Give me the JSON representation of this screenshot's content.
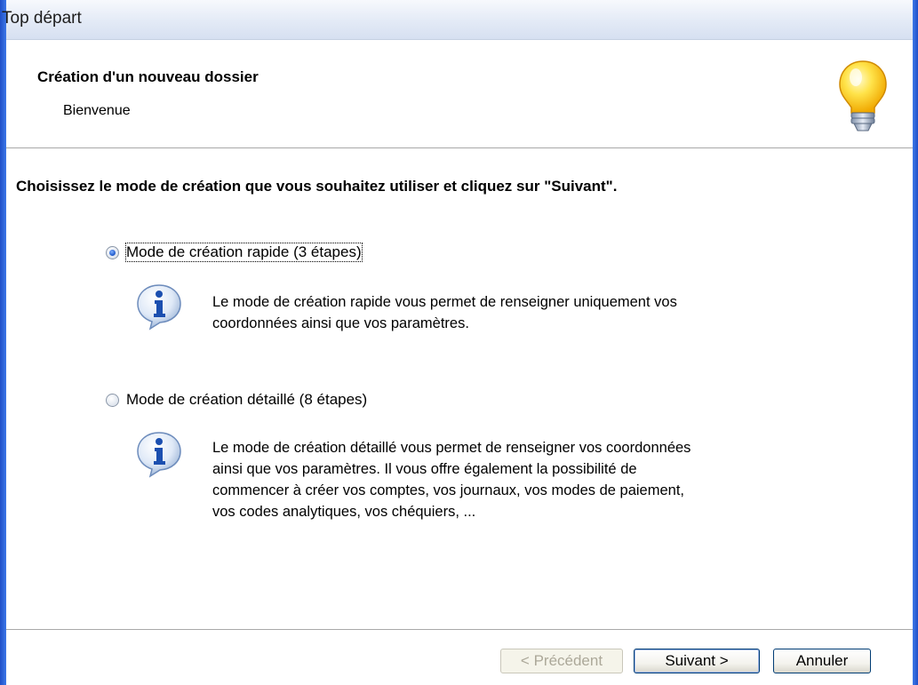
{
  "window": {
    "title": "Top départ"
  },
  "header": {
    "title": "Création d'un nouveau dossier",
    "subtitle": "Bienvenue",
    "icon": "lightbulb-icon"
  },
  "instruction": "Choisissez le mode de création que vous souhaitez utiliser et cliquez sur \"Suivant\".",
  "options": [
    {
      "label": "Mode de création rapide (3 étapes)",
      "selected": true,
      "icon": "info-icon",
      "description": [
        "Le mode de création rapide vous permet de renseigner uniquement vos",
        "coordonnées ainsi que vos paramètres."
      ]
    },
    {
      "label": "Mode de création détaillé (8 étapes)",
      "selected": false,
      "icon": "info-icon",
      "description": [
        "Le mode de création détaillé vous permet de renseigner  vos coordonnées",
        "ainsi que vos paramètres. Il vous offre également la possibilité de",
        "commencer à créer vos comptes, vos journaux, vos modes de paiement,",
        "vos codes analytiques, vos chéquiers,  ..."
      ]
    }
  ],
  "buttons": {
    "previous": "< Précédent",
    "next": "Suivant >",
    "cancel": "Annuler"
  },
  "colors": {
    "window_frame": "#2a5bd0",
    "titlebar": "#e3eaf6",
    "button_border": "#003c74"
  }
}
